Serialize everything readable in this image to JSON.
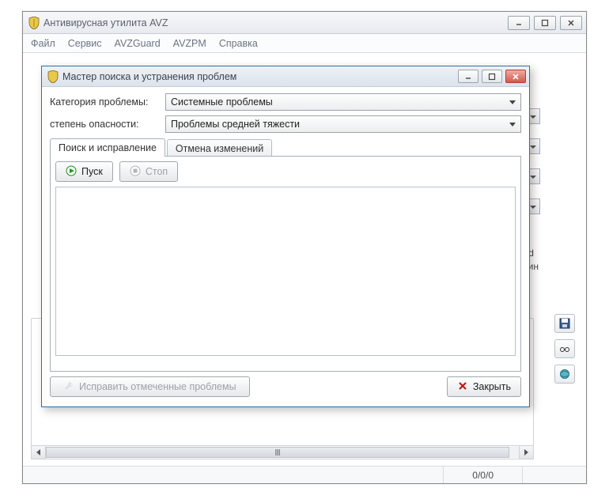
{
  "parent_window": {
    "title": "Антивирусная утилита AVZ",
    "menu": {
      "file": "Файл",
      "service": "Сервис",
      "avzguard": "AVZGuard",
      "avzpm": "AVZPM",
      "help": "Справка"
    },
    "background": {
      "text1": "nfected",
      "text2": "арантин"
    },
    "status": {
      "counter": "0/0/0"
    }
  },
  "dialog": {
    "title": "Мастер поиска и устранения проблем",
    "labels": {
      "category": "Категория проблемы:",
      "severity": "степень опасности:"
    },
    "values": {
      "category": "Системные проблемы",
      "severity": "Проблемы средней тяжести"
    },
    "tabs": {
      "searchfix": "Поиск и исправление",
      "undo": "Отмена изменений"
    },
    "buttons": {
      "start": "Пуск",
      "stop": "Стоп",
      "fix": "Исправить отмеченные проблемы",
      "close": "Закрыть"
    }
  },
  "icons": {
    "play": "play-icon",
    "stop": "stop-icon",
    "close_x": "close-icon",
    "shield": "shield-icon"
  }
}
